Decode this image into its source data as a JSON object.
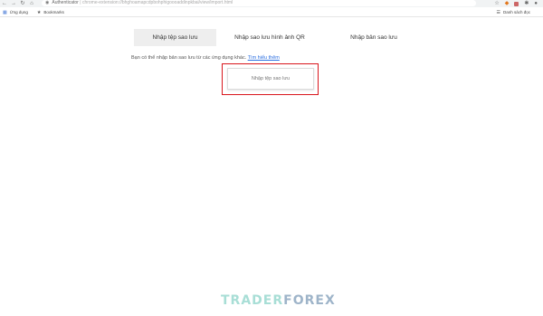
{
  "browser": {
    "url_host": "Authenticator",
    "url_path": "chrome-extension://bhghoamapcdpbohphigoooaddinpkbai/view/import.html",
    "bookmarks": [
      {
        "icon": "apps-icon",
        "label": "Ứng dụng"
      },
      {
        "icon": "star-icon",
        "label": "Bookmarks"
      }
    ],
    "reading_list": "Danh sách đọc"
  },
  "tabs": [
    {
      "label": "Nhập tệp sao lưu",
      "active": true
    },
    {
      "label": "Nhập sao lưu hình ảnh QR",
      "active": false
    },
    {
      "label": "Nhập bản sao lưu",
      "active": false
    }
  ],
  "help": {
    "text": "Bạn có thể nhập bản sao lưu từ các ứng dụng khác.",
    "link": "Tìm hiểu thêm"
  },
  "import_button": {
    "label": "Nhập tệp sao lưu"
  },
  "colors": {
    "highlight": "#d9161c",
    "link": "#2a6ee0",
    "active_tab": "#eeeeee"
  },
  "watermark": {
    "part1": "TRADER",
    "part2": "FOREX"
  }
}
